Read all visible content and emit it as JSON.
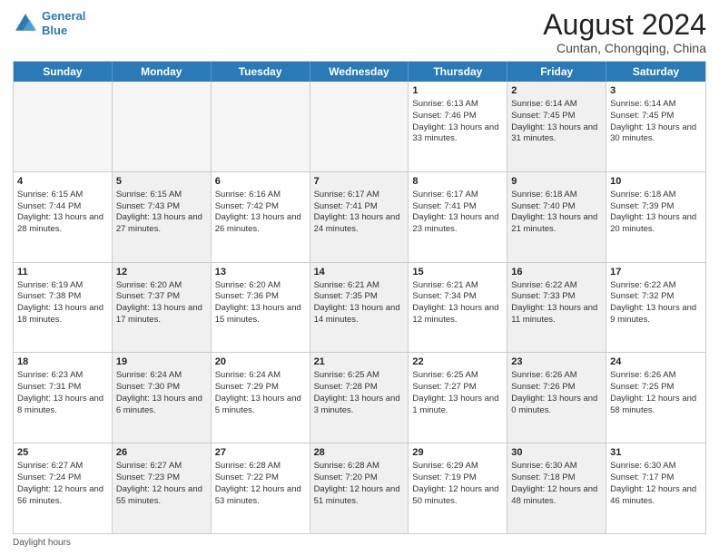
{
  "logo": {
    "line1": "General",
    "line2": "Blue"
  },
  "title": "August 2024",
  "location": "Cuntan, Chongqing, China",
  "weekdays": [
    "Sunday",
    "Monday",
    "Tuesday",
    "Wednesday",
    "Thursday",
    "Friday",
    "Saturday"
  ],
  "footer": "Daylight hours",
  "rows": [
    [
      {
        "day": "",
        "info": "",
        "shaded": true
      },
      {
        "day": "",
        "info": "",
        "shaded": true
      },
      {
        "day": "",
        "info": "",
        "shaded": true
      },
      {
        "day": "",
        "info": "",
        "shaded": true
      },
      {
        "day": "1",
        "info": "Sunrise: 6:13 AM\nSunset: 7:46 PM\nDaylight: 13 hours and 33 minutes."
      },
      {
        "day": "2",
        "info": "Sunrise: 6:14 AM\nSunset: 7:45 PM\nDaylight: 13 hours and 31 minutes.",
        "shaded": true
      },
      {
        "day": "3",
        "info": "Sunrise: 6:14 AM\nSunset: 7:45 PM\nDaylight: 13 hours and 30 minutes."
      }
    ],
    [
      {
        "day": "4",
        "info": "Sunrise: 6:15 AM\nSunset: 7:44 PM\nDaylight: 13 hours and 28 minutes."
      },
      {
        "day": "5",
        "info": "Sunrise: 6:15 AM\nSunset: 7:43 PM\nDaylight: 13 hours and 27 minutes.",
        "shaded": true
      },
      {
        "day": "6",
        "info": "Sunrise: 6:16 AM\nSunset: 7:42 PM\nDaylight: 13 hours and 26 minutes."
      },
      {
        "day": "7",
        "info": "Sunrise: 6:17 AM\nSunset: 7:41 PM\nDaylight: 13 hours and 24 minutes.",
        "shaded": true
      },
      {
        "day": "8",
        "info": "Sunrise: 6:17 AM\nSunset: 7:41 PM\nDaylight: 13 hours and 23 minutes."
      },
      {
        "day": "9",
        "info": "Sunrise: 6:18 AM\nSunset: 7:40 PM\nDaylight: 13 hours and 21 minutes.",
        "shaded": true
      },
      {
        "day": "10",
        "info": "Sunrise: 6:18 AM\nSunset: 7:39 PM\nDaylight: 13 hours and 20 minutes."
      }
    ],
    [
      {
        "day": "11",
        "info": "Sunrise: 6:19 AM\nSunset: 7:38 PM\nDaylight: 13 hours and 18 minutes."
      },
      {
        "day": "12",
        "info": "Sunrise: 6:20 AM\nSunset: 7:37 PM\nDaylight: 13 hours and 17 minutes.",
        "shaded": true
      },
      {
        "day": "13",
        "info": "Sunrise: 6:20 AM\nSunset: 7:36 PM\nDaylight: 13 hours and 15 minutes."
      },
      {
        "day": "14",
        "info": "Sunrise: 6:21 AM\nSunset: 7:35 PM\nDaylight: 13 hours and 14 minutes.",
        "shaded": true
      },
      {
        "day": "15",
        "info": "Sunrise: 6:21 AM\nSunset: 7:34 PM\nDaylight: 13 hours and 12 minutes."
      },
      {
        "day": "16",
        "info": "Sunrise: 6:22 AM\nSunset: 7:33 PM\nDaylight: 13 hours and 11 minutes.",
        "shaded": true
      },
      {
        "day": "17",
        "info": "Sunrise: 6:22 AM\nSunset: 7:32 PM\nDaylight: 13 hours and 9 minutes."
      }
    ],
    [
      {
        "day": "18",
        "info": "Sunrise: 6:23 AM\nSunset: 7:31 PM\nDaylight: 13 hours and 8 minutes."
      },
      {
        "day": "19",
        "info": "Sunrise: 6:24 AM\nSunset: 7:30 PM\nDaylight: 13 hours and 6 minutes.",
        "shaded": true
      },
      {
        "day": "20",
        "info": "Sunrise: 6:24 AM\nSunset: 7:29 PM\nDaylight: 13 hours and 5 minutes."
      },
      {
        "day": "21",
        "info": "Sunrise: 6:25 AM\nSunset: 7:28 PM\nDaylight: 13 hours and 3 minutes.",
        "shaded": true
      },
      {
        "day": "22",
        "info": "Sunrise: 6:25 AM\nSunset: 7:27 PM\nDaylight: 13 hours and 1 minute."
      },
      {
        "day": "23",
        "info": "Sunrise: 6:26 AM\nSunset: 7:26 PM\nDaylight: 13 hours and 0 minutes.",
        "shaded": true
      },
      {
        "day": "24",
        "info": "Sunrise: 6:26 AM\nSunset: 7:25 PM\nDaylight: 12 hours and 58 minutes."
      }
    ],
    [
      {
        "day": "25",
        "info": "Sunrise: 6:27 AM\nSunset: 7:24 PM\nDaylight: 12 hours and 56 minutes."
      },
      {
        "day": "26",
        "info": "Sunrise: 6:27 AM\nSunset: 7:23 PM\nDaylight: 12 hours and 55 minutes.",
        "shaded": true
      },
      {
        "day": "27",
        "info": "Sunrise: 6:28 AM\nSunset: 7:22 PM\nDaylight: 12 hours and 53 minutes."
      },
      {
        "day": "28",
        "info": "Sunrise: 6:28 AM\nSunset: 7:20 PM\nDaylight: 12 hours and 51 minutes.",
        "shaded": true
      },
      {
        "day": "29",
        "info": "Sunrise: 6:29 AM\nSunset: 7:19 PM\nDaylight: 12 hours and 50 minutes."
      },
      {
        "day": "30",
        "info": "Sunrise: 6:30 AM\nSunset: 7:18 PM\nDaylight: 12 hours and 48 minutes.",
        "shaded": true
      },
      {
        "day": "31",
        "info": "Sunrise: 6:30 AM\nSunset: 7:17 PM\nDaylight: 12 hours and 46 minutes."
      }
    ]
  ]
}
